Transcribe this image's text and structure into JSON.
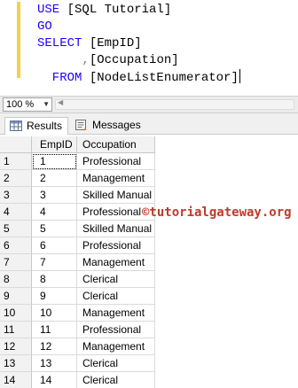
{
  "editor": {
    "lines": [
      {
        "parts": [
          {
            "t": "USE ",
            "c": "kw"
          },
          {
            "t": "[SQL Tutorial]",
            "c": "plain"
          }
        ]
      },
      {
        "parts": [
          {
            "t": "GO",
            "c": "kw"
          }
        ]
      },
      {
        "parts": [
          {
            "t": "SELECT ",
            "c": "kw"
          },
          {
            "t": "[EmpID]",
            "c": "plain"
          }
        ]
      },
      {
        "parts": [
          {
            "t": "      ",
            "c": "plain"
          },
          {
            "t": ",",
            "c": "gray"
          },
          {
            "t": "[Occupation]",
            "c": "plain"
          }
        ]
      },
      {
        "parts": [
          {
            "t": "  FROM ",
            "c": "kw"
          },
          {
            "t": "[NodeListEnumerator]",
            "c": "plain"
          }
        ]
      }
    ]
  },
  "status": {
    "zoom": "100 %"
  },
  "tabs": [
    {
      "label": "Results",
      "icon": "grid-icon",
      "active": true
    },
    {
      "label": "Messages",
      "icon": "messages-icon",
      "active": false
    }
  ],
  "grid": {
    "columns": [
      "EmpID",
      "Occupation"
    ],
    "rows": [
      [
        "1",
        "1",
        "Professional"
      ],
      [
        "2",
        "2",
        "Management"
      ],
      [
        "3",
        "3",
        "Skilled Manual"
      ],
      [
        "4",
        "4",
        "Professional"
      ],
      [
        "5",
        "5",
        "Skilled Manual"
      ],
      [
        "6",
        "6",
        "Professional"
      ],
      [
        "7",
        "7",
        "Management"
      ],
      [
        "8",
        "8",
        "Clerical"
      ],
      [
        "9",
        "9",
        "Clerical"
      ],
      [
        "10",
        "10",
        "Management"
      ],
      [
        "11",
        "11",
        "Professional"
      ],
      [
        "12",
        "12",
        "Management"
      ],
      [
        "13",
        "13",
        "Clerical"
      ],
      [
        "14",
        "14",
        "Clerical"
      ]
    ]
  },
  "watermark": "©tutorialgateway.org",
  "colors": {
    "keyword": "#1f00ff",
    "change_bar": "#f3d14b",
    "watermark": "#c0392b"
  }
}
